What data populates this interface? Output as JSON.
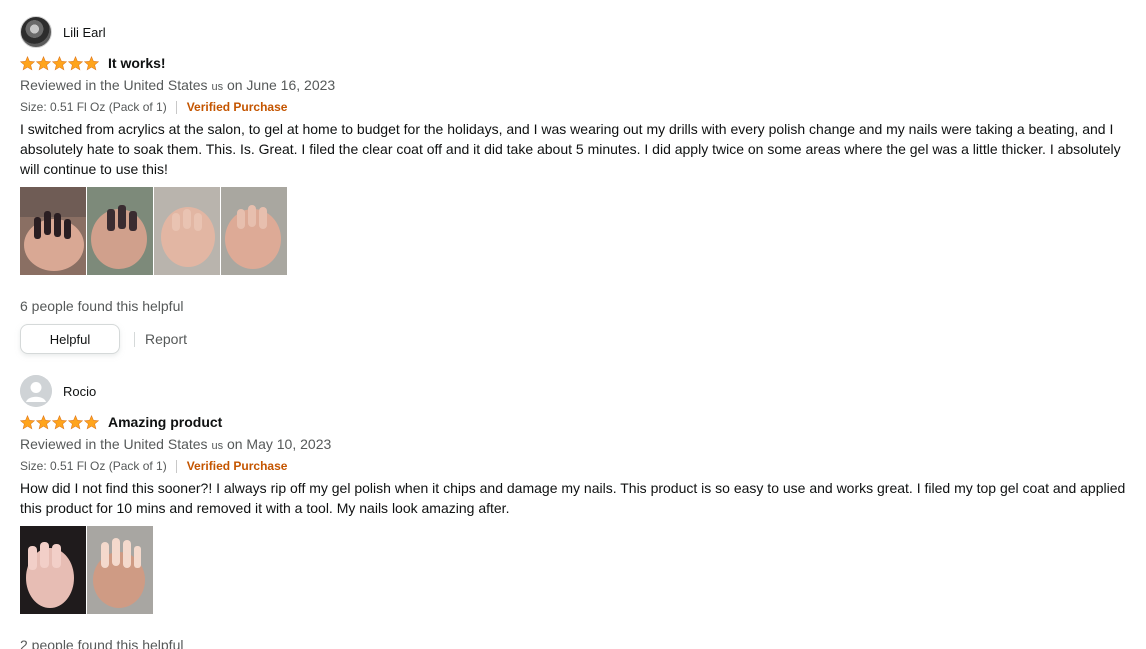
{
  "colors": {
    "star": "#ffa41c",
    "verified": "#c45500",
    "secondary_text": "#565959"
  },
  "reviews": [
    {
      "profile_name": "Lili Earl",
      "avatar": "profile-photo",
      "rating": 5,
      "title": "It works!",
      "date_prefix": "Reviewed in the United States",
      "flag": "us",
      "date_suffix": "on June 16, 2023",
      "size": "Size: 0.51 Fl Oz (Pack of 1)",
      "verified": "Verified Purchase",
      "body": "I switched from acrylics at the salon, to gel at home to budget for the holidays, and I was wearing out my drills with every polish change and my nails were taking a beating, and I absolutely hate to soak them. This. Is. Great. I filed the clear coat off and it did take about 5 minutes. I did apply twice on some areas where the gel was a little thicker. I absolutely will continue to use this!",
      "image_count": 4,
      "helpful_text": "6 people found this helpful",
      "helpful_button": "Helpful",
      "report_link": "Report"
    },
    {
      "profile_name": "Rocio",
      "avatar": "default-avatar",
      "rating": 5,
      "title": "Amazing product",
      "date_prefix": "Reviewed in the United States",
      "flag": "us",
      "date_suffix": "on May 10, 2023",
      "size": "Size: 0.51 Fl Oz (Pack of 1)",
      "verified": "Verified Purchase",
      "body": "How did I not find this sooner?! I always rip off my gel polish when it chips and damage my nails. This product is so easy to use and works great. I filed my top gel coat and applied this product for 10 mins and removed it with a tool. My nails look amazing after.",
      "image_count": 2,
      "helpful_text": "2 people found this helpful"
    }
  ]
}
